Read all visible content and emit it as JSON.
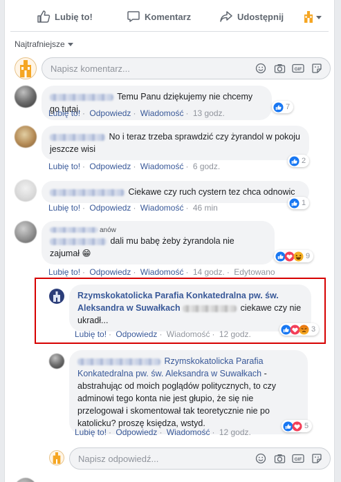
{
  "actions": {
    "like": "Lubię to!",
    "comment": "Komentarz",
    "share": "Udostępnij"
  },
  "sort_label": "Najtrafniejsze",
  "composer_placeholder": "Napisz komentarz...",
  "reply_placeholder": "Napisz odpowiedź...",
  "meta_labels": {
    "like": "Lubię to!",
    "reply": "Odpowiedz",
    "message": "Wiadomość",
    "edited": "Edytowano"
  },
  "comments": [
    {
      "text": "Temu Panu dziękujemy nie chcemy go tutaj.",
      "time": "13 godz.",
      "reactions": "7"
    },
    {
      "text": "No i teraz trzeba sprawdzić czy żyrandol w pokoju jeszcze wisi",
      "time": "6 godz.",
      "reactions": "2"
    },
    {
      "text": "Ciekawe czy ruch cystern tez chca odnowic",
      "time": "46 min",
      "reactions": "1"
    },
    {
      "name_suffix": "anów",
      "text": "dali mu babę żeby żyrandola nie zajumał 😁",
      "time": "14 godz.",
      "reactions": "9"
    }
  ],
  "replies": [
    {
      "author": "Rzymskokatolicka Parafia Konkatedralna pw. św. Aleksandra w Suwałkach",
      "text": "ciekawe czy nie ukradł...",
      "time": "12 godz.",
      "reactions": "3"
    },
    {
      "mention": "Rzymskokatolicka Parafia Konkatedralna pw. św. Aleksandra w Suwałkach",
      "text": "- abstrahując od moich poglądów politycznych, to czy adminowi tego konta nie jest głupio, że się nie przelogował i skomentował tak teoretycznie nie po katolicku? proszę księdza, wstyd.",
      "time": "12 godz.",
      "reactions": "5"
    }
  ],
  "colors": {
    "link": "#385898",
    "highlight_border": "#d60000",
    "bubble_bg": "#f2f3f5",
    "like_blue": "#1877f2",
    "love_red": "#f33e58",
    "angry_orange": "#e9710f"
  }
}
